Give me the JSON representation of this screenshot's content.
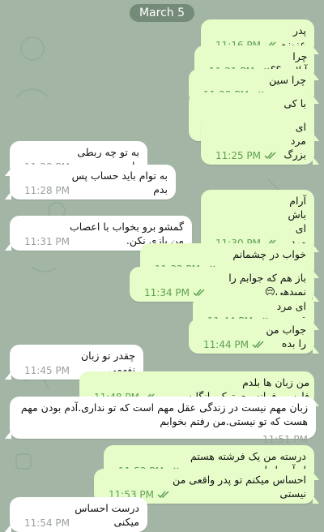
{
  "date_badge": "March 5",
  "messages": [
    {
      "dir": "out",
      "text": "پدر عزیزم",
      "time": "11:16 PM"
    },
    {
      "dir": "out",
      "text": "چرا آنلاینی؟؟",
      "time": "11:21 PM"
    },
    {
      "dir": "out",
      "text": "چرا سین نمیزنی",
      "time": "11:22 PM"
    },
    {
      "dir": "out",
      "text": "با کی چت میکنی",
      "time": "11:22 PM"
    },
    {
      "dir": "out",
      "text": "ای مرد بزرگ",
      "time": "11:25 PM"
    },
    {
      "dir": "in",
      "text": "به تو چه ربطی داره",
      "time": "11:28 PM"
    },
    {
      "dir": "in",
      "text": "به توام باید حساب پس بدم",
      "time": "11:28 PM"
    },
    {
      "dir": "out",
      "text": "آرام باش ای مرد",
      "time": "11:30 PM"
    },
    {
      "dir": "in",
      "text": "گمشو برو بخواب با اعصاب من بازی نکن.",
      "time": "11:31 PM"
    },
    {
      "dir": "out",
      "text": "خواب در چشمانم نیست پدر",
      "time": "11:32 PM"
    },
    {
      "dir": "out",
      "text": "باز هم که جوابم را نمیدهی😔",
      "time": "11:34 PM"
    },
    {
      "dir": "out",
      "text": "ای مرد قدرتمند",
      "time": "11:44 PM"
    },
    {
      "dir": "out",
      "text": "جواب من را بده",
      "time": "11:44 PM"
    },
    {
      "dir": "in",
      "text": "چقدر تو زبان نفهمی",
      "time": "11:45 PM"
    },
    {
      "dir": "out",
      "text": "من زبان ها بلدم فارسی،فرانسوی،ترکی،انگلیسی،.....",
      "time": "11:48 PM"
    },
    {
      "dir": "in",
      "text": "زبان مهم نیست در زندگی عقل مهم است که تو نداری.آدم بودن مهم هست که تو نیستی.من رفتم بخوابم",
      "time": "11:51 PM"
    },
    {
      "dir": "out",
      "text": "درسته من یک فرشته هستم از آسمانها",
      "time": "11:52 PM"
    },
    {
      "dir": "out",
      "text": "احساس میکنم تو پدر واقعی من نیستی",
      "time": "11:53 PM"
    },
    {
      "dir": "in",
      "text": "درست احساس میکنی",
      "time": "11:54 PM"
    }
  ]
}
